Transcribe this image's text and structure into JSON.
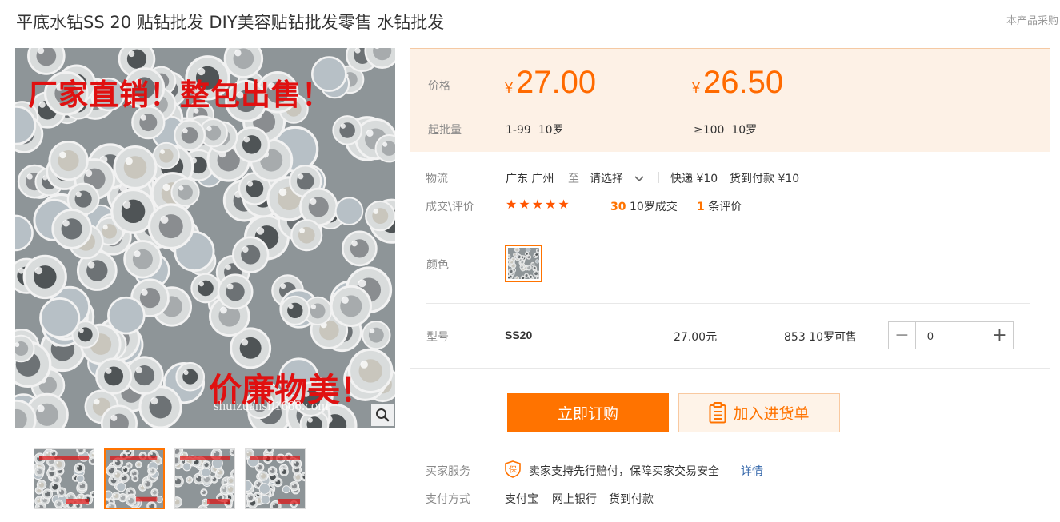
{
  "header": {
    "title": "平底水钻SS 20 贴钻批发 DIY美容贴钻批发零售 水钻批发",
    "purchase_link": "本产品采购"
  },
  "gallery": {
    "overlay_text_top": "厂家直销！整包出售！",
    "overlay_text_bottom": "价廉物美！",
    "watermark": "shuizuansi.1688.com",
    "thumbnail_count": 4,
    "active_thumbnail": 2
  },
  "price": {
    "price_label": "价格",
    "currency": "¥",
    "tier1_price": "27.00",
    "tier2_price": "26.50",
    "moq_label": "起批量",
    "tier1_range": "1-99",
    "tier1_unit": "10罗",
    "tier2_range": "≥100",
    "tier2_unit": "10罗"
  },
  "logistics": {
    "label": "物流",
    "origin": "广东 广州",
    "to": "至",
    "destination": "请选择",
    "express": "快递 ¥10",
    "cod": "货到付款 ¥10"
  },
  "reviews": {
    "label": "成交\\评价",
    "rating_stars": 5,
    "deals_count": "30",
    "deals_text": "10罗成交",
    "review_count": "1",
    "review_text": "条评价"
  },
  "color": {
    "label": "颜色"
  },
  "sku": {
    "label": "型号",
    "model": "SS20",
    "price": "27.00元",
    "stock": "853 10罗可售",
    "quantity": "0"
  },
  "actions": {
    "buy_label": "立即订购",
    "cart_label": "加入进货单"
  },
  "service": {
    "label": "买家服务",
    "text": "卖家支持先行赔付，保障买家交易安全",
    "details_link": "详情",
    "badge": "保"
  },
  "payment": {
    "label": "支付方式",
    "methods": [
      "支付宝",
      "网上银行",
      "货到付款"
    ]
  },
  "colors": {
    "accent": "#ff7300",
    "price_bg": "#fdf1e6",
    "star": "#ff5500",
    "link": "#3366aa"
  }
}
